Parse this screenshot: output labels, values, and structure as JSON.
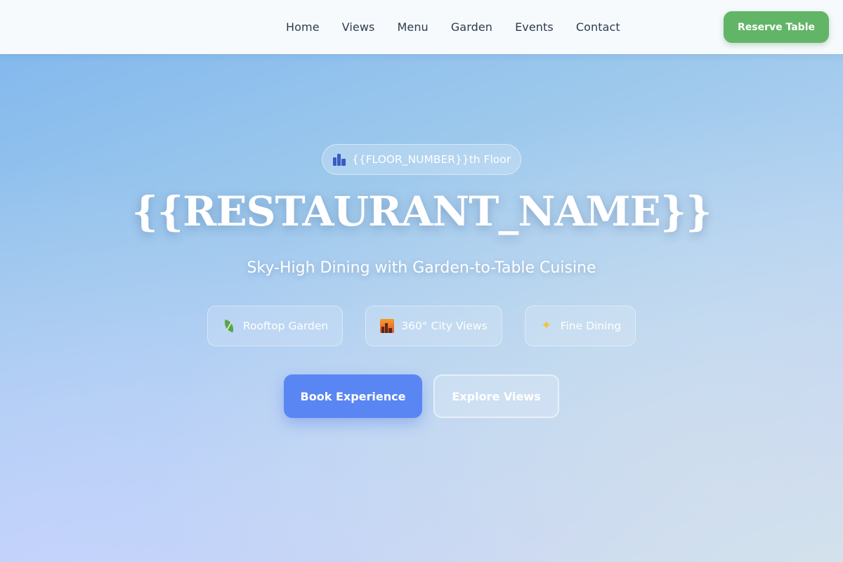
{
  "header": {
    "nav": [
      "Home",
      "Views",
      "Menu",
      "Garden",
      "Events",
      "Contact"
    ],
    "reserve_label": "Reserve Table"
  },
  "hero": {
    "floor_badge": "{{FLOOR_NUMBER}}th Floor",
    "title": "{{RESTAURANT_NAME}}",
    "subtitle": "Sky-High Dining with Garden-to-Table Cuisine",
    "features": [
      {
        "icon": "leaf-icon",
        "label": "Rooftop Garden"
      },
      {
        "icon": "city-sunset-icon",
        "label": "360° City Views"
      },
      {
        "icon": "sparkles-icon",
        "label": "Fine Dining"
      }
    ],
    "primary_button": "Book Experience",
    "secondary_button": "Explore Views"
  },
  "colors": {
    "accent_green": "#62b566",
    "accent_blue": "#5a86f3",
    "nav_text": "#2f3b4f"
  }
}
